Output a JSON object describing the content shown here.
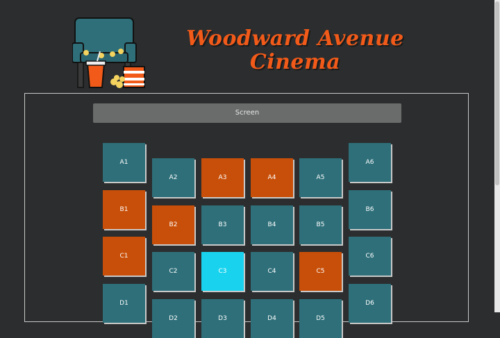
{
  "header": {
    "title_line1": "Woodward Avenue",
    "title_line2": "Cinema",
    "logo_icon": "cinema-seat-popcorn-logo"
  },
  "screen": {
    "label": "Screen"
  },
  "colors": {
    "available": "#2e6f79",
    "taken": "#c84f09",
    "selected": "#19d3ee",
    "accent": "#f25a19"
  },
  "seats": [
    {
      "label": "A1",
      "status": "available"
    },
    {
      "label": "A2",
      "status": "available"
    },
    {
      "label": "A3",
      "status": "taken"
    },
    {
      "label": "A4",
      "status": "taken"
    },
    {
      "label": "A5",
      "status": "available"
    },
    {
      "label": "A6",
      "status": "available"
    },
    {
      "label": "B1",
      "status": "taken"
    },
    {
      "label": "B2",
      "status": "taken"
    },
    {
      "label": "B3",
      "status": "available"
    },
    {
      "label": "B4",
      "status": "available"
    },
    {
      "label": "B5",
      "status": "available"
    },
    {
      "label": "B6",
      "status": "available"
    },
    {
      "label": "C1",
      "status": "taken"
    },
    {
      "label": "C2",
      "status": "available"
    },
    {
      "label": "C3",
      "status": "selected"
    },
    {
      "label": "C4",
      "status": "available"
    },
    {
      "label": "C5",
      "status": "taken"
    },
    {
      "label": "C6",
      "status": "available"
    },
    {
      "label": "D1",
      "status": "available"
    },
    {
      "label": "D2",
      "status": "available"
    },
    {
      "label": "D3",
      "status": "available"
    },
    {
      "label": "D4",
      "status": "available"
    },
    {
      "label": "D5",
      "status": "available"
    },
    {
      "label": "D6",
      "status": "available"
    }
  ]
}
